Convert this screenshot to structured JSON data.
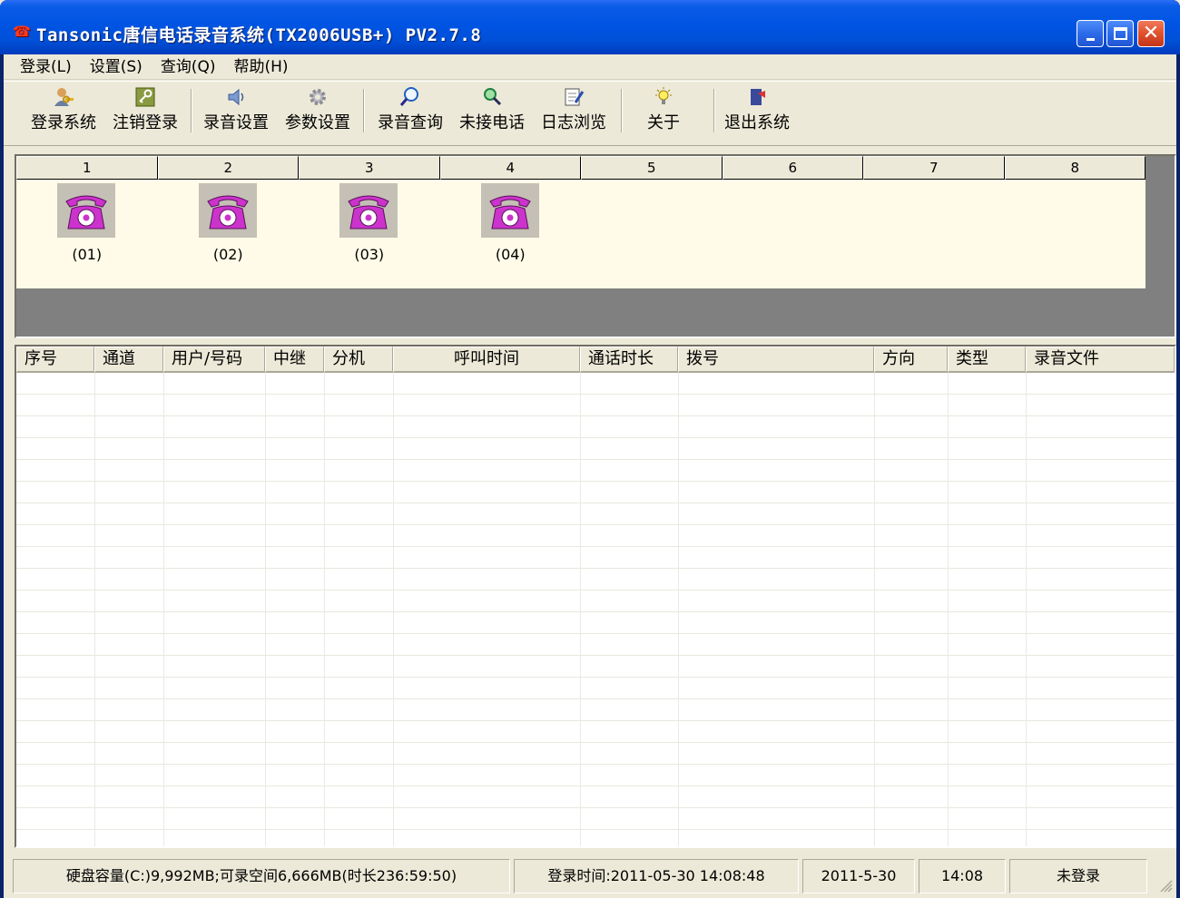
{
  "window": {
    "title": "Tansonic唐信电话录音系统(TX2006USB+) PV2.7.8",
    "icon": "phone-icon",
    "controls": {
      "minimize": "minimize-icon",
      "maximize": "maximize-icon",
      "close": "✕"
    }
  },
  "menu": [
    {
      "label": "登录(L)"
    },
    {
      "label": "设置(S)"
    },
    {
      "label": "查询(Q)"
    },
    {
      "label": "帮助(H)"
    }
  ],
  "toolbar": {
    "items": [
      {
        "label": "登录系统",
        "icon": "user-key-icon"
      },
      {
        "label": "注销登录",
        "icon": "key-icon"
      },
      {
        "label": "录音设置",
        "icon": "speaker-icon"
      },
      {
        "label": "参数设置",
        "icon": "gear-icon"
      },
      {
        "label": "录音查询",
        "icon": "magnifier-icon"
      },
      {
        "label": "未接电话",
        "icon": "search-phone-icon"
      },
      {
        "label": "日志浏览",
        "icon": "log-edit-icon"
      },
      {
        "label": "关于",
        "icon": "lightbulb-icon"
      },
      {
        "label": "退出系统",
        "icon": "exit-door-icon"
      }
    ]
  },
  "channels": {
    "headers": [
      "1",
      "2",
      "3",
      "4",
      "5",
      "6",
      "7",
      "8"
    ],
    "lines": [
      {
        "label": "(01)",
        "icon": "telephone-icon"
      },
      {
        "label": "(02)",
        "icon": "telephone-icon"
      },
      {
        "label": "(03)",
        "icon": "telephone-icon"
      },
      {
        "label": "(04)",
        "icon": "telephone-icon"
      }
    ],
    "phone_color": "#cc33cc"
  },
  "table": {
    "columns": [
      "序号",
      "通道",
      "用户/号码",
      "中继",
      "分机",
      "呼叫时间",
      "通话时长",
      "拨号",
      "方向",
      "类型",
      "录音文件"
    ],
    "rows": []
  },
  "status": {
    "disk": "硬盘容量(C:)9,992MB;可录空间6,666MB(时长236:59:50)",
    "login_time": "登录时间:2011-05-30 14:08:48",
    "date": "2011-5-30",
    "time": "14:08",
    "login_state": "未登录"
  }
}
